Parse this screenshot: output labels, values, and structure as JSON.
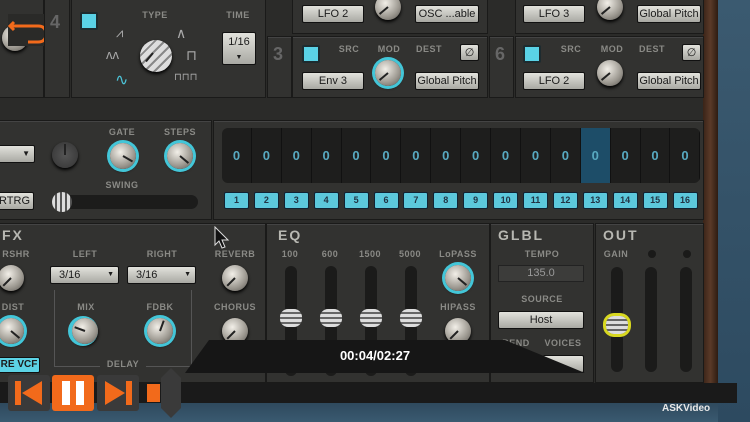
{
  "top": {
    "slot_left_number": "4",
    "lfo": {
      "type_label": "TYPE",
      "time_label": "TIME",
      "time_value": "1/16"
    },
    "slot3": {
      "number": "3",
      "row1_src": "LFO 2",
      "row1_dest": "OSC ...able",
      "src_label": "SRC",
      "mod_label": "MOD",
      "dest_label": "DEST",
      "src": "Env 3",
      "dest": "Global Pitch",
      "bypass": "∅"
    },
    "slot6": {
      "number": "6",
      "row1_src": "LFO 3",
      "row1_dest": "Global Pitch",
      "src_label": "SRC",
      "mod_label": "MOD",
      "dest_label": "DEST",
      "src": "LFO 2",
      "dest": "Global Pitch",
      "bypass": "∅"
    }
  },
  "arp": {
    "gate_label": "GATE",
    "steps_label": "STEPS",
    "swing_label": "SWING",
    "rtrg_label": "RTRG"
  },
  "sequencer": {
    "values": [
      "0",
      "0",
      "0",
      "0",
      "0",
      "0",
      "0",
      "0",
      "0",
      "0",
      "0",
      "0",
      "0",
      "0",
      "0",
      "0"
    ],
    "steps": [
      "1",
      "2",
      "3",
      "4",
      "5",
      "6",
      "7",
      "8",
      "9",
      "10",
      "11",
      "12",
      "13",
      "14",
      "15",
      "16"
    ],
    "active_step": 13
  },
  "fx": {
    "title": "FX",
    "rshr_label": "RSHR",
    "left_label": "LEFT",
    "left_value": "3/16",
    "right_label": "RIGHT",
    "right_value": "3/16",
    "reverb_label": "REVERB",
    "dist_label": "DIST",
    "mix_label": "MIX",
    "fdbk_label": "FDBK",
    "chorus_label": "CHORUS",
    "delay_label": "DELAY",
    "vcf_button": "RE VCF"
  },
  "eq": {
    "title": "EQ",
    "bands": [
      "100",
      "600",
      "1500",
      "5000"
    ],
    "lopass_label": "LoPASS",
    "hipass_label": "HIPASS"
  },
  "glbl": {
    "title": "GLBL",
    "tempo_label": "TEMPO",
    "tempo_value": "135.0",
    "source_label": "SOURCE",
    "source_value": "Host",
    "bend_label": "BEND",
    "voices_label": "VOICES"
  },
  "out": {
    "title": "OUT",
    "gain_label": "GAIN"
  },
  "player": {
    "time": "00:04/02:27",
    "brand": "ASKVideo"
  }
}
